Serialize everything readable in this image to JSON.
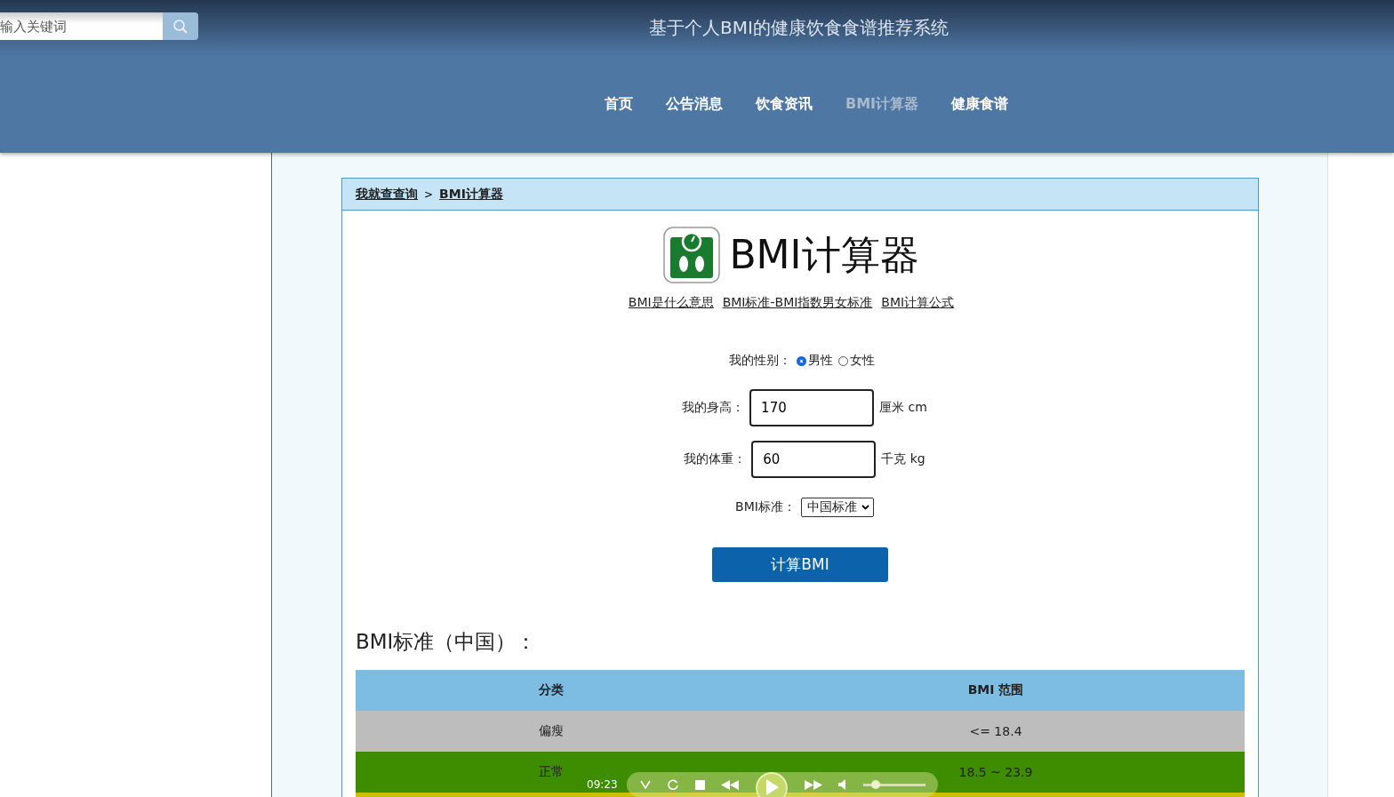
{
  "header": {
    "search": {
      "placeholder": "输入关键词"
    },
    "title": "基于个人BMI的健康饮食食谱推荐系统"
  },
  "nav": [
    {
      "label": "首页",
      "selected": false
    },
    {
      "label": "公告消息",
      "selected": false
    },
    {
      "label": "饮食资讯",
      "selected": false
    },
    {
      "label": "BMI计算器",
      "selected": true
    },
    {
      "label": "健康食谱",
      "selected": false
    }
  ],
  "breadcrumb": {
    "home": "我就查查询",
    "separator": ">",
    "current": "BMI计算器"
  },
  "calculator": {
    "title": "BMI计算器",
    "links": [
      "BMI是什么意思",
      "BMI标准-BMI指数男女标准",
      "BMI计算公式"
    ],
    "gender": {
      "label": "我的性别：",
      "options": [
        {
          "label": "男性",
          "selected": true
        },
        {
          "label": "女性",
          "selected": false
        }
      ]
    },
    "height": {
      "label": "我的身高：",
      "value": "170",
      "unit": "厘米 cm"
    },
    "weight": {
      "label": "我的体重：",
      "value": "60",
      "unit": "千克 kg"
    },
    "standard": {
      "label": "BMI标准：",
      "value": "中国标准"
    },
    "button": "计算BMI"
  },
  "standard_table": {
    "heading": "BMI标准（中国）：",
    "columns": [
      "分类",
      "BMI 范围"
    ],
    "rows": [
      {
        "cells": [
          "偏瘦",
          "<= 18.4"
        ],
        "color": "#bdbdbd"
      },
      {
        "cells": [
          "正常",
          "18.5 ~ 23.9"
        ],
        "color": "#3e8c00"
      },
      {
        "cells": [],
        "color": "#c8c000"
      }
    ]
  },
  "player": {
    "time": "09:23",
    "level": 0.2
  }
}
